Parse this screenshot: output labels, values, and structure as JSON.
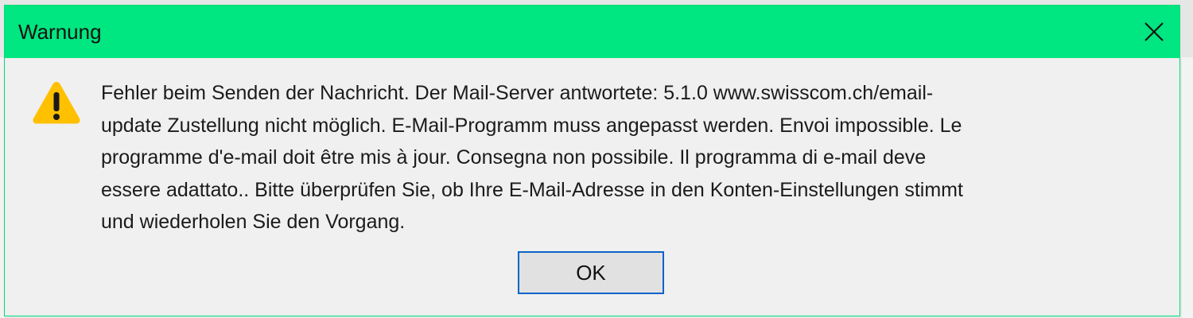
{
  "window": {
    "title": "Warnung",
    "title_bar_color": "#00e680"
  },
  "icons": {
    "warning": "warning-triangle-icon",
    "close": "close-x-icon"
  },
  "message": {
    "lines": [
      "Fehler beim Senden der Nachricht. Der Mail-Server antwortete: 5.1.0 www.swisscom.ch/email-",
      "update  Zustellung nicht möglich. E-Mail-Programm muss angepasst werden.  Envoi impossible. Le",
      "programme d'e-mail doit être mis à jour.  Consegna non possibile. Il programma di e-mail deve",
      "essere adattato.. Bitte überprüfen Sie, ob Ihre E-Mail-Adresse in den Konten-Einstellungen stimmt",
      "und wiederholen Sie den Vorgang."
    ]
  },
  "buttons": {
    "ok_label": "OK"
  },
  "colors": {
    "warning_icon": "#ffc000",
    "ok_button_border": "#0a64c8"
  }
}
